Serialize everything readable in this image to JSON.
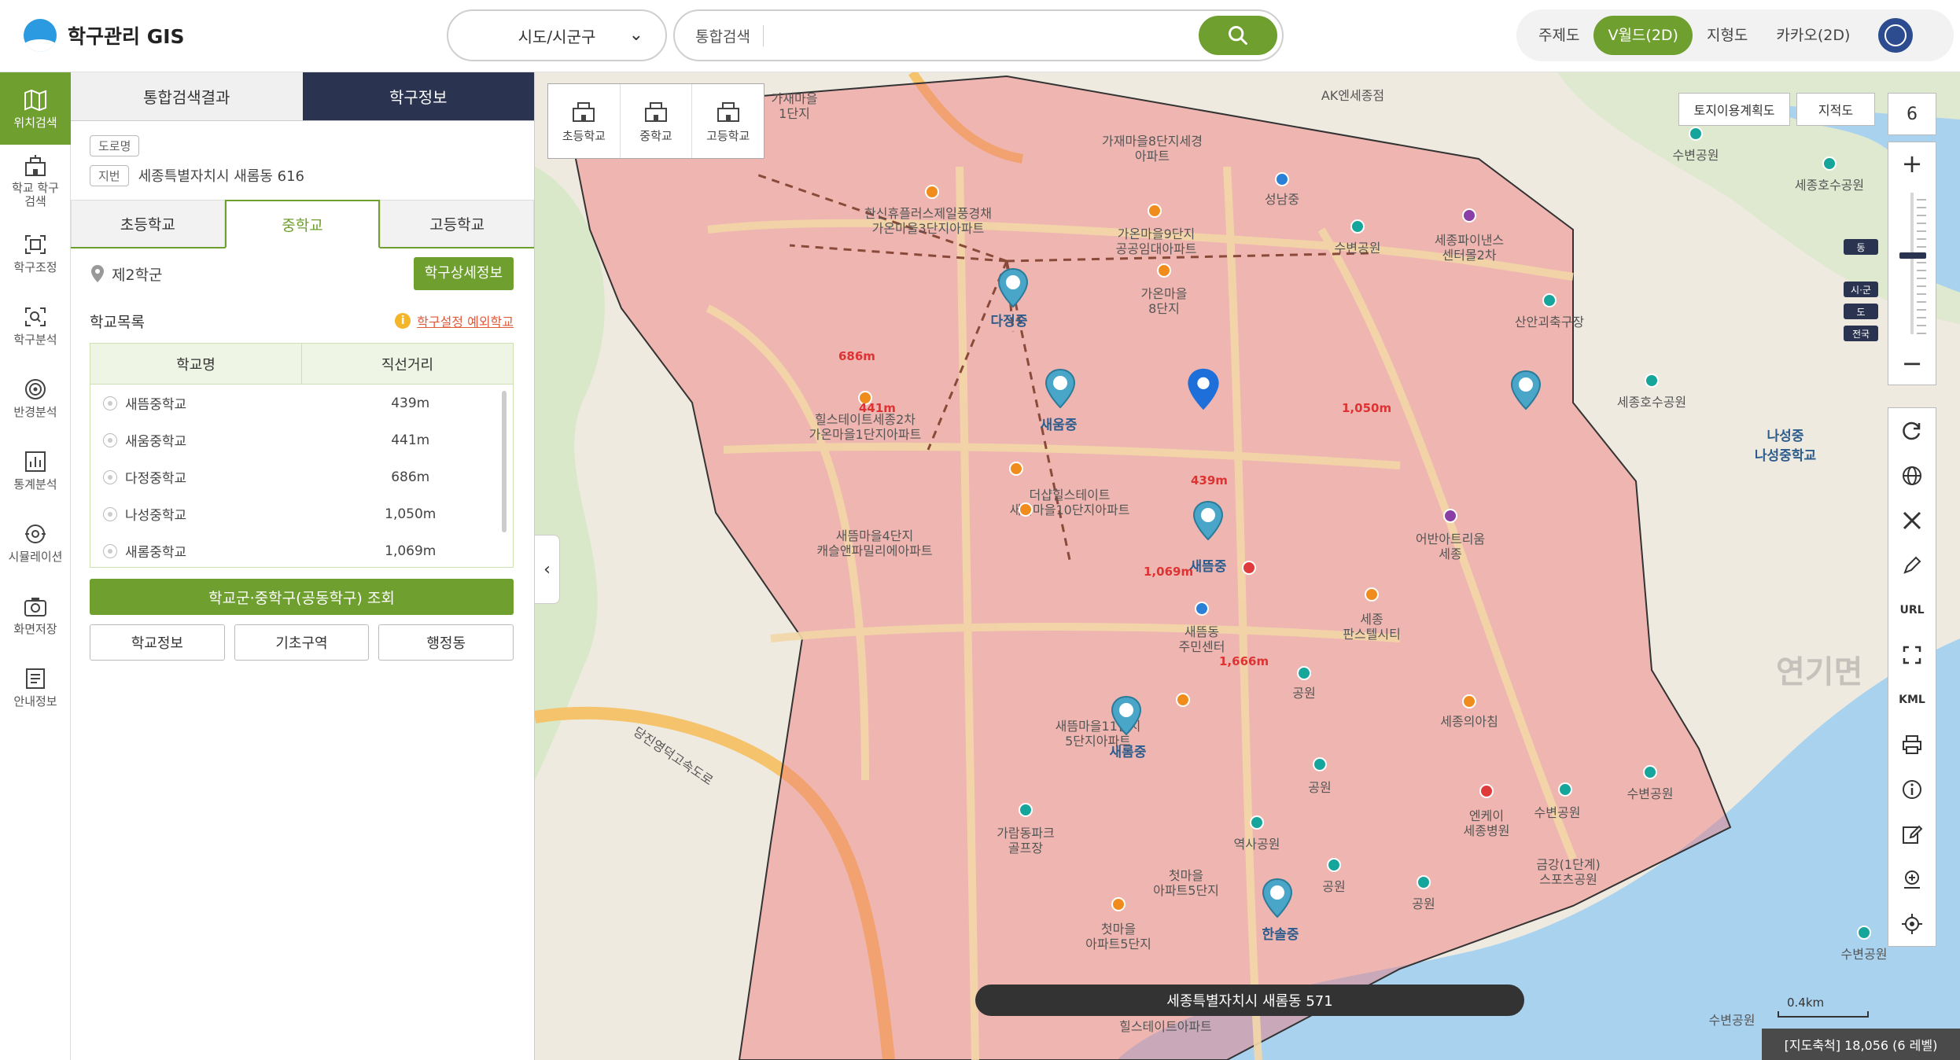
{
  "app": {
    "title": "학구관리 GIS"
  },
  "header": {
    "region_select": "시도/시군구",
    "search_label": "통합검색",
    "search_placeholder": "",
    "map_types": [
      "주제도",
      "V월드(2D)",
      "지형도",
      "카카오(2D)"
    ],
    "active_map_type": "V월드(2D)"
  },
  "rail": [
    {
      "label": "위치검색",
      "icon": "map-icon",
      "active": true
    },
    {
      "label": "학교 학구\n검색",
      "icon": "school-building-icon"
    },
    {
      "label": "학구조정",
      "icon": "adjust-icon"
    },
    {
      "label": "학구분석",
      "icon": "analysis-search-icon"
    },
    {
      "label": "반경분석",
      "icon": "radius-icon"
    },
    {
      "label": "통계분석",
      "icon": "statistics-icon"
    },
    {
      "label": "시뮬레이션",
      "icon": "simulation-icon"
    },
    {
      "label": "화면저장",
      "icon": "camera-icon"
    },
    {
      "label": "안내정보",
      "icon": "guide-icon"
    }
  ],
  "panel": {
    "tabs": [
      "통합검색결과",
      "학구정보"
    ],
    "active_tab": "학구정보",
    "address": {
      "road_tag": "도로명",
      "road_value": "",
      "lot_tag": "지번",
      "lot_value": "세종특별자치시 새롬동 616"
    },
    "school_tabs": [
      "초등학교",
      "중학교",
      "고등학교"
    ],
    "active_school_tab": "중학교",
    "district": "제2학군",
    "district_detail_btn": "학구상세정보",
    "list_title": "학교목록",
    "except_link": "학구설정 예외학교",
    "table_headers": [
      "학교명",
      "직선거리"
    ],
    "schools": [
      {
        "name": "새뜸중학교",
        "distance": "439m"
      },
      {
        "name": "새움중학교",
        "distance": "441m"
      },
      {
        "name": "다정중학교",
        "distance": "686m"
      },
      {
        "name": "나성중학교",
        "distance": "1,050m"
      },
      {
        "name": "새롬중학교",
        "distance": "1,069m"
      }
    ],
    "query_btn": "학교군·중학구(공동학구) 조회",
    "bottom_btns": [
      "학교정보",
      "기초구역",
      "행정동"
    ]
  },
  "map": {
    "school_filter": [
      "초등학교",
      "중학교",
      "고등학교"
    ],
    "top_btns": [
      "토지이용계획도",
      "지적도"
    ],
    "zoom_level": "6",
    "level_tags": [
      "동",
      "시·군",
      "도",
      "전국"
    ],
    "tools": [
      "refresh-icon",
      "globe-icon",
      "measure-icon",
      "pen-icon",
      "URL",
      "fullscreen-icon",
      "KML",
      "print-icon",
      "info-icon",
      "edit-icon",
      "zoom-area-icon",
      "locate-icon"
    ],
    "address_bar": "세종특별자치시 새롬동 571",
    "scale_label": "0.4km",
    "map_scale": "[지도축척] 18,056 (6 레벨)",
    "watermark": "연기면",
    "distances": [
      "686m",
      "441m",
      "1,050m",
      "439m",
      "1,069m",
      "1,666m"
    ],
    "school_labels": [
      "다정중",
      "새움중",
      "나성중\n나성중학교",
      "새뜸중",
      "새롬중",
      "한솔중"
    ],
    "labels": [
      "가재마을\n1단지",
      "AK엔세종점",
      "가재마을8단지세경\n아파트",
      "한신휴플러스제일풍경채\n가온마을3단지아파트",
      "가온마을9단지\n공공임대아파트",
      "가온마을\n8단지",
      "성남중",
      "수변공원",
      "세종파이낸스\n센터몰2차",
      "수변공원",
      "세종호수공원",
      "산안괴축구장",
      "세종호수공원",
      "힐스테이트세종2차\n가온마을1단지아파트",
      "더샵힐스테이트\n새뜸마을10단지아파트",
      "새뜸마을4단지\n캐슬앤파밀리에아파트",
      "어반아트리움\n세종",
      "새뜸동\n주민센터",
      "세종\n판스텔시티",
      "공원",
      "새뜸마을11단지\n5단지아파트",
      "세종의아침",
      "공원",
      "엔케이\n세종병원",
      "수변공원",
      "수변공원",
      "가람동파크\n골프장",
      "역사공원",
      "금강(1단계)\n스포츠공원",
      "공원",
      "공원",
      "첫마을\n아파트5단지",
      "첫마을\n아파트5단지",
      "수변공원",
      "수변공원",
      "힐스테이트아파트",
      "당진영덕고속도로"
    ]
  }
}
